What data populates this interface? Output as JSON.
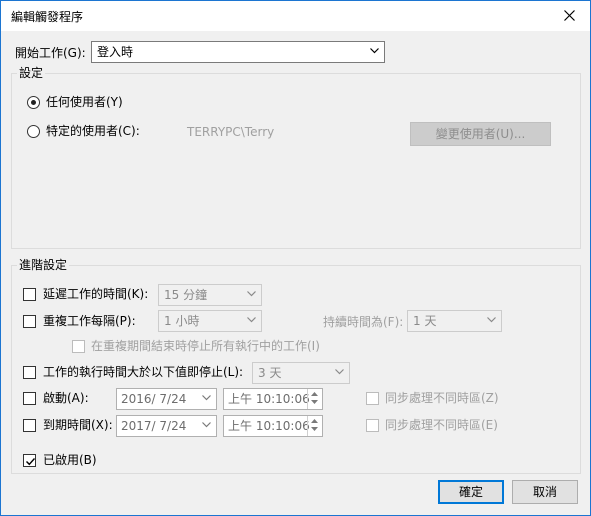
{
  "window": {
    "title": "編輯觸發程序"
  },
  "begin_task": {
    "label": "開始工作(G):",
    "value": "登入時"
  },
  "settings": {
    "title": "設定",
    "any_user_label": "任何使用者(Y)",
    "specific_user_label": "特定的使用者(C):",
    "user_name": "TERRYPC\\Terry",
    "change_user_button": "變更使用者(U)..."
  },
  "advanced": {
    "title": "進階設定",
    "delay": {
      "label": "延遲工作的時間(K):",
      "value": "15 分鐘"
    },
    "repeat": {
      "label": "重複工作每隔(P):",
      "value": "1 小時",
      "duration_label": "持續時間為(F):",
      "duration_value": "1 天"
    },
    "stop_at_end_label": "在重複期間結束時停止所有執行中的工作(I)",
    "stop_if_longer": {
      "label": "工作的執行時間大於以下值即停止(L):",
      "value": "3 天"
    },
    "activate": {
      "label": "啟動(A):",
      "date": "2016/ 7/24",
      "time": "上午 10:10:06",
      "sync_label": "同步處理不同時區(Z)"
    },
    "expire": {
      "label": "到期時間(X):",
      "date": "2017/ 7/24",
      "time": "上午 10:10:06",
      "sync_label": "同步處理不同時區(E)"
    },
    "enabled_label": "已啟用(B)"
  },
  "buttons": {
    "ok": "確定",
    "cancel": "取消"
  },
  "colors": {
    "accent": "#0078d7",
    "window_border": "#1c75d1"
  }
}
